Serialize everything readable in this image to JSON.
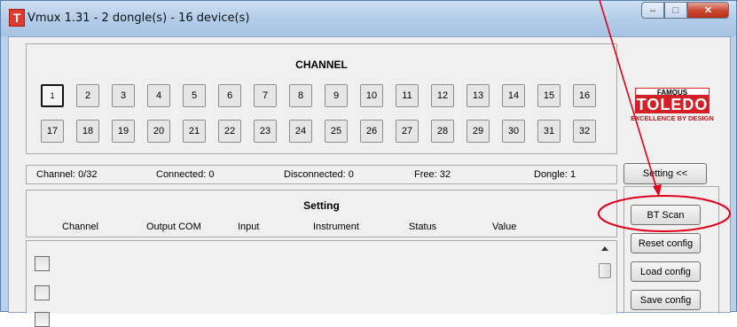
{
  "window": {
    "title": "Vmux 1.31 - 2 dongle(s) - 16 device(s)",
    "app_icon_letter": "T",
    "controls": {
      "minimize": "–",
      "maximize": "□",
      "close": "✕"
    }
  },
  "channel": {
    "title": "CHANNEL",
    "buttons": [
      "1",
      "2",
      "3",
      "4",
      "5",
      "6",
      "7",
      "8",
      "9",
      "10",
      "11",
      "12",
      "13",
      "14",
      "15",
      "16",
      "17",
      "18",
      "19",
      "20",
      "21",
      "22",
      "23",
      "24",
      "25",
      "26",
      "27",
      "28",
      "29",
      "30",
      "31",
      "32"
    ],
    "selected": "1"
  },
  "logo": {
    "top": "FAMOUS",
    "main": "TOLEDO",
    "tagline": "EXCELLENCE BY DESIGN"
  },
  "status": {
    "channel": "Channel: 0/32",
    "connected": "Connected: 0",
    "disconnected": "Disconnected: 0",
    "free": "Free: 32",
    "dongle": "Dongle: 1"
  },
  "setting_toggle_label": "Setting <<",
  "setting": {
    "title": "Setting",
    "columns": [
      "Channel",
      "Output COM",
      "Input",
      "Instrument",
      "Status",
      "Value"
    ]
  },
  "side_buttons": {
    "bt_scan": "BT Scan",
    "reset": "Reset config",
    "load": "Load config",
    "save": "Save config"
  },
  "colors": {
    "annotation": "#e0001b",
    "logo_red": "#d41f26",
    "titlebar": "#b9d1ea"
  }
}
